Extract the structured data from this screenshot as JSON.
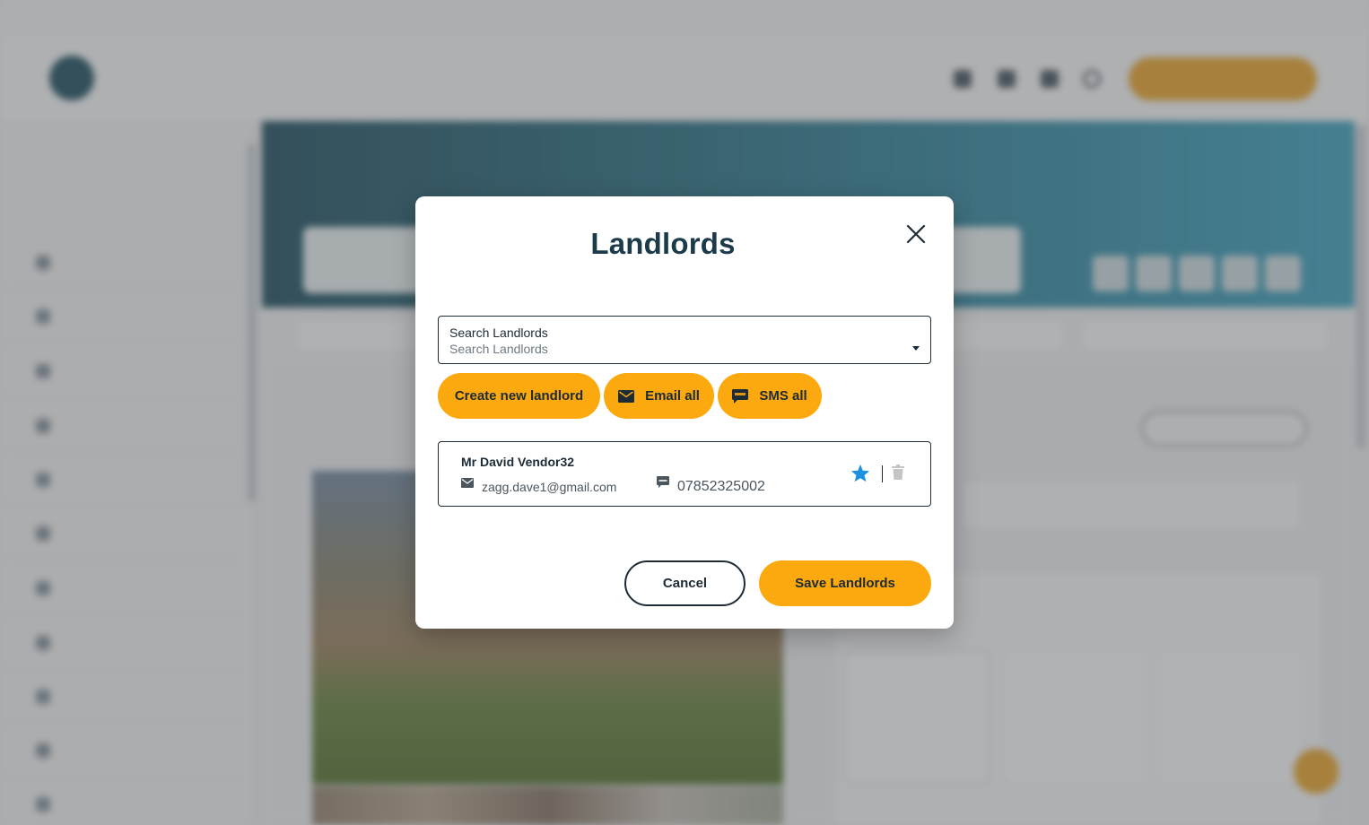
{
  "colors": {
    "accent": "#fca90f",
    "brand_dark": "#1b3b4a",
    "star": "#1e90e0",
    "trash": "#c4c4c4"
  },
  "modal": {
    "title": "Landlords",
    "close_icon": "close-icon",
    "search": {
      "label": "Search Landlords",
      "placeholder": "Search Landlords",
      "value": ""
    },
    "actions": {
      "create_label": "Create new landlord",
      "email_label": "Email all",
      "email_icon": "envelope-icon",
      "sms_label": "SMS all",
      "sms_icon": "sms-icon"
    },
    "landlords": [
      {
        "name": "Mr David Vendor32",
        "email": "zagg.dave1@gmail.com",
        "phone": "07852325002",
        "primary": true
      }
    ],
    "footer": {
      "cancel_label": "Cancel",
      "save_label": "Save Landlords"
    }
  }
}
